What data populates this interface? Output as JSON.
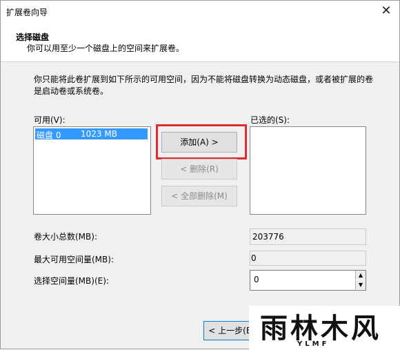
{
  "window": {
    "title": "扩展卷向导"
  },
  "header": {
    "title": "选择磁盘",
    "subtitle": "你可以用至少一个磁盘上的空间来扩展卷。"
  },
  "description": "你只能将此卷扩展到如下所示的可用空间，因为不能将磁盘转换为动态磁盘，或者被扩展的卷是启动卷或系统卷。",
  "available": {
    "label": "可用(V):",
    "items": [
      {
        "disk": "磁盘 0",
        "size": "1023 MB"
      }
    ]
  },
  "selected": {
    "label": "已选的(S):"
  },
  "buttons": {
    "add": "添加(A) >",
    "remove": "< 删除(R)",
    "remove_all": "< 全部删除(M)",
    "back": "< 上一步(B)"
  },
  "fields": {
    "total_label": "卷大小总数(MB):",
    "total_value": "203776",
    "max_label": "最大可用空间量(MB):",
    "max_value": "0",
    "select_label": "选择空间量(MB)(E):",
    "select_value": "0"
  },
  "highlight_color": "#e22b2b",
  "watermark": {
    "main": "雨林木风",
    "sub": "YLMF"
  }
}
